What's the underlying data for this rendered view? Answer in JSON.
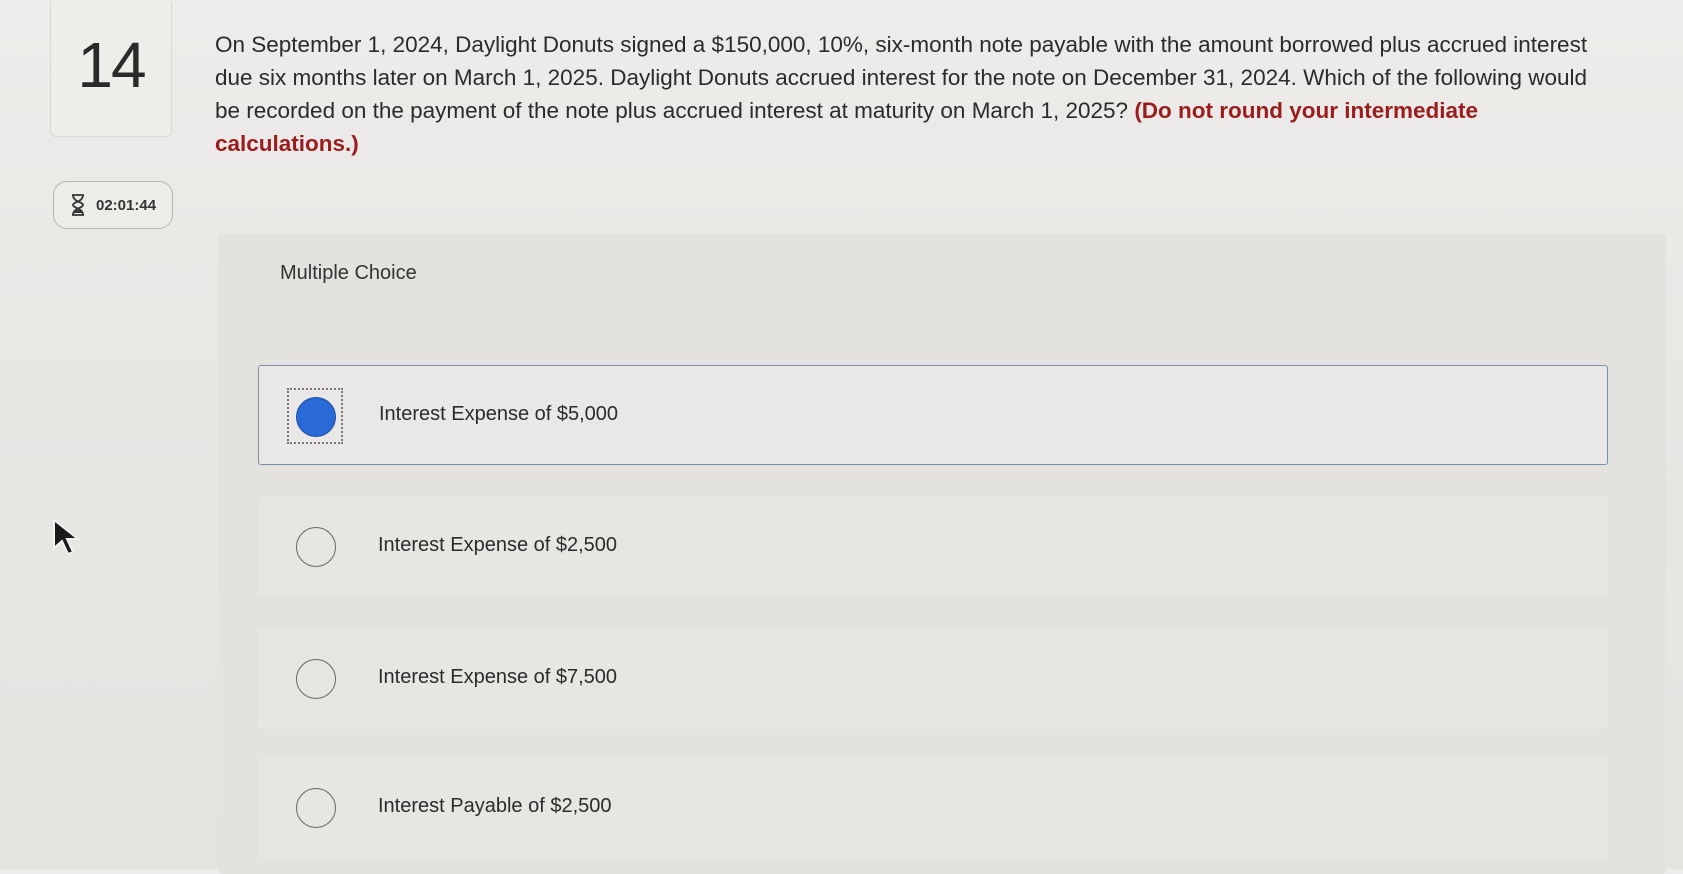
{
  "question": {
    "number": "14",
    "text": "On September 1, 2024, Daylight Donuts signed a $150,000, 10%, six-month note payable with the amount borrowed plus accrued interest due six months later on March 1, 2025. Daylight Donuts accrued interest for the note on December 31, 2024. Which of the following would be recorded on the payment of the note plus accrued interest at maturity on March 1, 2025?",
    "hint": "(Do not round your intermediate calculations.)"
  },
  "timer": {
    "value": "02:01:44",
    "icon": "hourglass-icon"
  },
  "answers": {
    "section_label": "Multiple Choice",
    "options": [
      {
        "label": "Interest Expense of $5,000",
        "selected": true
      },
      {
        "label": "Interest Expense of $2,500",
        "selected": false
      },
      {
        "label": "Interest Expense of $7,500",
        "selected": false
      },
      {
        "label": "Interest Payable of $2,500",
        "selected": false
      }
    ]
  },
  "colors": {
    "hint_text": "#9b1c1c",
    "selected_radio": "#2a6ad6"
  }
}
